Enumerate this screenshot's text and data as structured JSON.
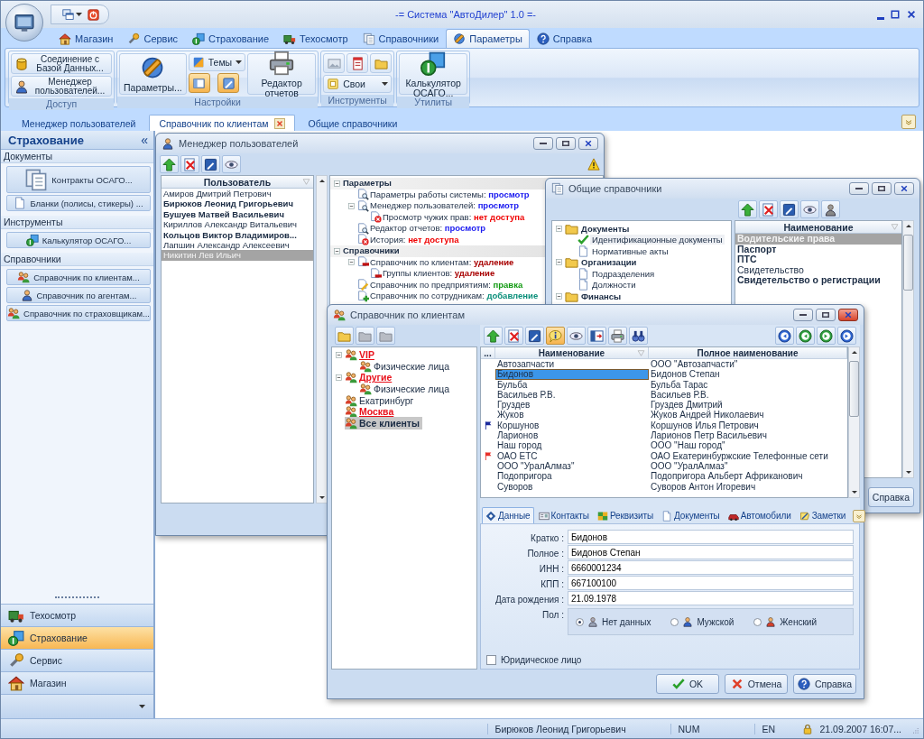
{
  "window": {
    "title": "-= Система \"АвтоДилер\" 1.0 =-"
  },
  "ribbon": {
    "tabs": [
      {
        "label": "Магазин",
        "selected": false
      },
      {
        "label": "Сервис",
        "selected": false
      },
      {
        "label": "Страхование",
        "selected": false
      },
      {
        "label": "Техосмотр",
        "selected": false
      },
      {
        "label": "Справочники",
        "selected": false
      },
      {
        "label": "Параметры",
        "selected": true
      },
      {
        "label": "Справка",
        "selected": false
      }
    ],
    "groups": [
      {
        "label": "Доступ",
        "columns": [
          [
            {
              "kind": "wide",
              "label": "Соединение с Базой Данных..."
            },
            {
              "kind": "wide",
              "label": "Менеджер пользователей..."
            }
          ]
        ]
      },
      {
        "label": "Настройки",
        "columns": [
          [
            {
              "kind": "large",
              "label": "Параметры..."
            }
          ],
          [
            {
              "kind": "dropdown",
              "label": "Темы"
            },
            {
              "kind": "toggle",
              "on": true
            },
            {
              "kind": "toggle",
              "on": true
            }
          ],
          [
            {
              "kind": "large",
              "label": "Редактор отчетов"
            }
          ]
        ]
      },
      {
        "label": "Инструменты",
        "columns": [
          [
            {
              "kind": "icon"
            },
            {
              "kind": "icon"
            },
            {
              "kind": "icon"
            },
            {
              "kind": "dropdown",
              "label": "Свои"
            }
          ]
        ]
      },
      {
        "label": "Утилиты",
        "columns": [
          [
            {
              "kind": "large",
              "label": "Калькулятор ОСАГО..."
            }
          ]
        ]
      }
    ]
  },
  "document_tabs": [
    {
      "label": "Менеджер пользователей",
      "selected": false
    },
    {
      "label": "Справочник по клиентам",
      "selected": true,
      "closable": true
    },
    {
      "label": "Общие справочники",
      "selected": false
    }
  ],
  "sidebar": {
    "title": "Страхование",
    "collapse": "«",
    "sections": [
      {
        "label": "Документы",
        "items": [
          {
            "label": "Контракты ОСАГО...",
            "kind": "large"
          },
          {
            "label": "Бланки (полисы, стикеры) ...",
            "kind": "small"
          }
        ]
      },
      {
        "label": "Инструменты",
        "items": [
          {
            "label": "Калькулятор ОСАГО...",
            "kind": "small"
          }
        ]
      },
      {
        "label": "Справочники",
        "items": [
          {
            "label": "Справочник по клиентам...",
            "kind": "small"
          },
          {
            "label": "Справочник по агентам...",
            "kind": "small"
          },
          {
            "label": "Справочник по страховщикам...",
            "kind": "small"
          }
        ]
      }
    ],
    "nav": [
      {
        "label": "Техосмотр",
        "selected": false
      },
      {
        "label": "Страхование",
        "selected": true
      },
      {
        "label": "Сервис",
        "selected": false
      },
      {
        "label": "Магазин",
        "selected": false
      }
    ]
  },
  "users_window": {
    "title": "Менеджер пользователей",
    "column": "Пользователь",
    "users": [
      {
        "name": "Амиров Дмитрий Петрович",
        "bold": false,
        "selected": false
      },
      {
        "name": "Бирюков Леонид Григорьевич",
        "bold": true,
        "selected": false
      },
      {
        "name": "Бушуев Матвей Васильевич",
        "bold": true,
        "selected": false
      },
      {
        "name": "Кириллов Александр Витальевич",
        "bold": false,
        "selected": false
      },
      {
        "name": "Кольцов Виктор Владимиров...",
        "bold": true,
        "selected": false
      },
      {
        "name": "Лапшин Александр Алексеевич",
        "bold": false,
        "selected": false
      },
      {
        "name": "Никитин Лев Ильич",
        "bold": false,
        "selected": true
      }
    ],
    "permissions": [
      {
        "label": "Параметры",
        "expanded": true,
        "children": [
          {
            "label": "Параметры работы системы:",
            "access": "просмотр",
            "kind": "view"
          },
          {
            "label": "Менеджер пользователей:",
            "access": "просмотр",
            "kind": "view",
            "expanded": true,
            "children": [
              {
                "label": "Просмотр чужих прав:",
                "access": "нет доступа",
                "kind": "none"
              }
            ]
          },
          {
            "label": "Редактор отчетов:",
            "access": "просмотр",
            "kind": "view"
          },
          {
            "label": "История:",
            "access": "нет доступа",
            "kind": "none"
          }
        ]
      },
      {
        "label": "Справочники",
        "expanded": true,
        "children": [
          {
            "label": "Справочник по клиентам:",
            "access": "удаление",
            "kind": "delete",
            "expanded": true,
            "children": [
              {
                "label": "Группы клиентов:",
                "access": "удаление",
                "kind": "delete"
              }
            ]
          },
          {
            "label": "Справочник по предприятиям:",
            "access": "правка",
            "kind": "edit"
          },
          {
            "label": "Справочник по сотрудникам:",
            "access": "добавление",
            "kind": "add"
          }
        ]
      }
    ]
  },
  "refs_window": {
    "title": "Общие справочники",
    "tree": [
      {
        "label": "Документы",
        "expanded": true,
        "children": [
          {
            "label": "Идентификационные документы",
            "selected": true
          },
          {
            "label": "Нормативные акты",
            "selected": false
          }
        ]
      },
      {
        "label": "Организации",
        "expanded": true,
        "children": [
          {
            "label": "Подразделения",
            "selected": false
          },
          {
            "label": "Должности",
            "selected": false
          }
        ]
      },
      {
        "label": "Финансы",
        "expanded": true
      }
    ],
    "column": "Наименование",
    "rows": [
      {
        "name": "Водительские права",
        "bold": true,
        "selected": true
      },
      {
        "name": "Паспорт",
        "bold": true,
        "selected": false
      },
      {
        "name": "ПТС",
        "bold": true,
        "selected": false
      },
      {
        "name": "Свидетельство",
        "bold": false,
        "selected": false
      },
      {
        "name": "Свидетельство о регистрации",
        "bold": true,
        "selected": false
      }
    ],
    "help_button": "Справка"
  },
  "clients_window": {
    "title": "Справочник по клиентам",
    "groups": [
      {
        "label": "VIP",
        "highlighted": true,
        "selected": false,
        "expanded": true,
        "children": [
          {
            "label": "Физические лица",
            "highlighted": false,
            "selected": false
          }
        ]
      },
      {
        "label": "Другие",
        "highlighted": true,
        "selected": false,
        "expanded": true,
        "children": [
          {
            "label": "Физические лица",
            "highlighted": false,
            "selected": false
          }
        ]
      },
      {
        "label": "Екатринбург",
        "highlighted": false,
        "selected": false
      },
      {
        "label": "Москва",
        "highlighted": true,
        "selected": false
      },
      {
        "label": "Все клиенты",
        "highlighted": false,
        "selected": true
      }
    ],
    "columns": [
      "...",
      "Наименование",
      "Полное наименование"
    ],
    "rows": [
      {
        "name": "Автозапчасти",
        "full": "ООО \"Автозапчасти\"",
        "selected": false
      },
      {
        "name": "Бидонов",
        "full": "Бидонов Степан",
        "selected": true
      },
      {
        "name": "Бульба",
        "full": "Бульба Тарас",
        "selected": false
      },
      {
        "name": "Васильев Р.В.",
        "full": "Васильев Р.В.",
        "selected": false
      },
      {
        "name": "Груздев",
        "full": "Груздев Дмитрий",
        "selected": false
      },
      {
        "name": "Жуков",
        "full": "Жуков Андрей Николаевич",
        "selected": false
      },
      {
        "name": "Коршунов",
        "full": "Коршунов Илья Петрович",
        "selected": false,
        "color": "#1a2a9c"
      },
      {
        "name": "Ларионов",
        "full": "Ларионов Петр Васильевич",
        "selected": false
      },
      {
        "name": "Наш город",
        "full": "ООО \"Наш город\"",
        "selected": false
      },
      {
        "name": "ОАО ЕТС",
        "full": "ОАО Екатеринбуржские Телефонные сети",
        "selected": false,
        "color": "#e8302a"
      },
      {
        "name": "ООО \"УралАлмаз\"",
        "full": "ООО \"УралАлмаз\"",
        "selected": false
      },
      {
        "name": "Подопригора",
        "full": "Подопригора Альберт Африканович",
        "selected": false
      },
      {
        "name": "Суворов",
        "full": "Суворов Антон Игоревич",
        "selected": false
      }
    ],
    "tabs": [
      {
        "label": "Данные",
        "selected": true
      },
      {
        "label": "Контакты",
        "selected": false
      },
      {
        "label": "Реквизиты",
        "selected": false
      },
      {
        "label": "Документы",
        "selected": false
      },
      {
        "label": "Автомобили",
        "selected": false
      },
      {
        "label": "Заметки",
        "selected": false
      }
    ],
    "fields": [
      {
        "label": "Кратко :",
        "value": "Бидонов"
      },
      {
        "label": "Полное :",
        "value": "Бидонов Степан"
      },
      {
        "label": "ИНН :",
        "value": "6660001234"
      },
      {
        "label": "КПП :",
        "value": "667100100"
      },
      {
        "label": "Дата рождения :",
        "value": "21.09.1978"
      }
    ],
    "gender": {
      "label": "Пол :",
      "options": [
        {
          "label": "Нет данных",
          "selected": true
        },
        {
          "label": "Мужской",
          "selected": false
        },
        {
          "label": "Женский",
          "selected": false
        }
      ]
    },
    "legal_entity": {
      "label": "Юридическое лицо",
      "checked": false
    },
    "buttons": [
      "OK",
      "Отмена",
      "Справка"
    ]
  },
  "status_bar": {
    "user": "Бирюков Леонид Григорьевич",
    "num": "NUM",
    "lang": "EN",
    "datetime": "21.09.2007 16:07..."
  }
}
